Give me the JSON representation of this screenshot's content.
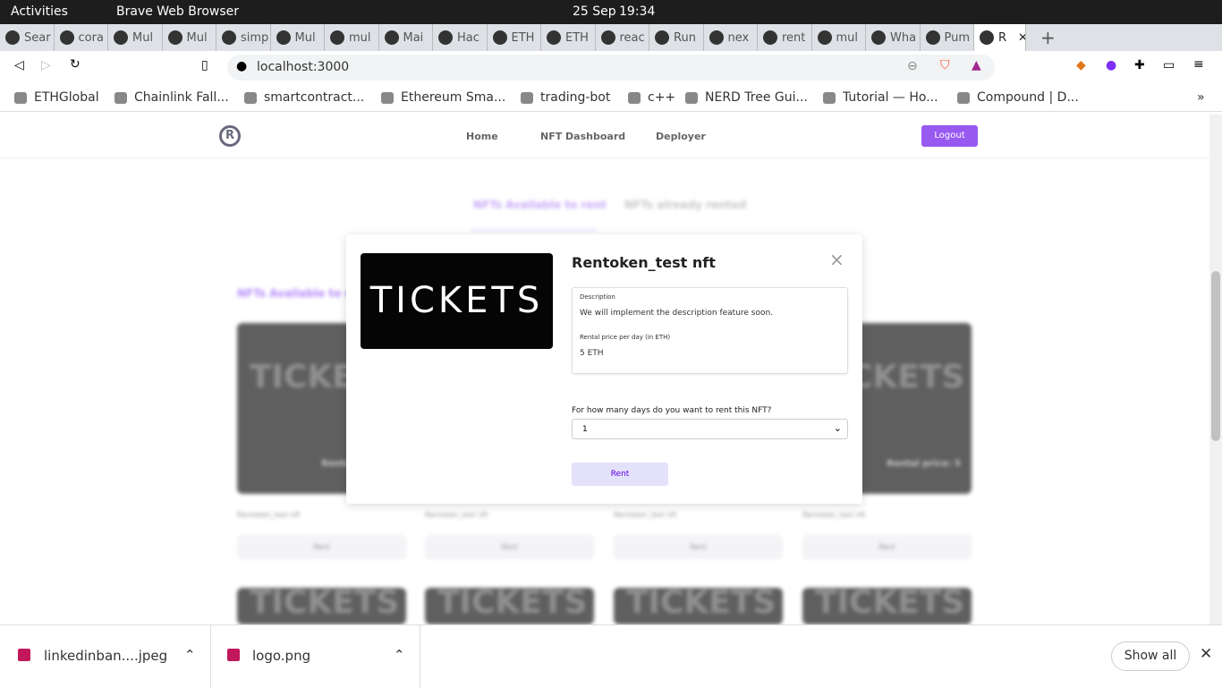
{
  "system": {
    "activities": "Activities",
    "app": "Brave Web Browser",
    "date": "25 Sep",
    "time": "19:34"
  },
  "tabs": [
    "Sear",
    "cora",
    "Mul",
    "Mul",
    "simp",
    "Mul",
    "mul",
    "Mai",
    "Hac",
    "ETH",
    "ETH",
    "reac",
    "Run",
    "nex",
    "rent",
    "mul",
    "Wha",
    "Pum",
    "R"
  ],
  "address": {
    "url": "localhost:3000"
  },
  "bookmarks": [
    "ETHGlobal",
    "Chainlink Fall...",
    "smartcontract...",
    "Ethereum Sma...",
    "trading-bot",
    "c++",
    "NERD Tree Gui...",
    "Tutorial — Ho...",
    "Compound | D..."
  ],
  "nav": {
    "logo": "R",
    "items": [
      "Home",
      "NFT Dashboard",
      "Deployer"
    ],
    "logout": "Logout"
  },
  "page_tabs": [
    "NFTs Available to rent",
    "NFTs already rented"
  ],
  "section_title": "NFTs Available to rent",
  "cards": [
    {
      "name": "Rentoken_test nft",
      "price": "Rental price: 5",
      "button": "Rent",
      "art": "TICKETS"
    }
  ],
  "modal": {
    "title": "Rentoken_test nft",
    "image_text": "TICKETS",
    "description_label": "Description",
    "description": "We will implement the description feature soon.",
    "price_label": "Rental price per day (in ETH)",
    "price": "5 ETH",
    "days_label": "For how many days do you want to rent this NFT?",
    "days_value": "1",
    "rent": "Rent",
    "close": "×"
  },
  "downloads": [
    {
      "name": "linkedinban....jpeg"
    },
    {
      "name": "logo.png"
    }
  ],
  "show_all": "Show all",
  "colors": {
    "accent": "#6200ea",
    "rent_bg": "#e4e1fb"
  }
}
